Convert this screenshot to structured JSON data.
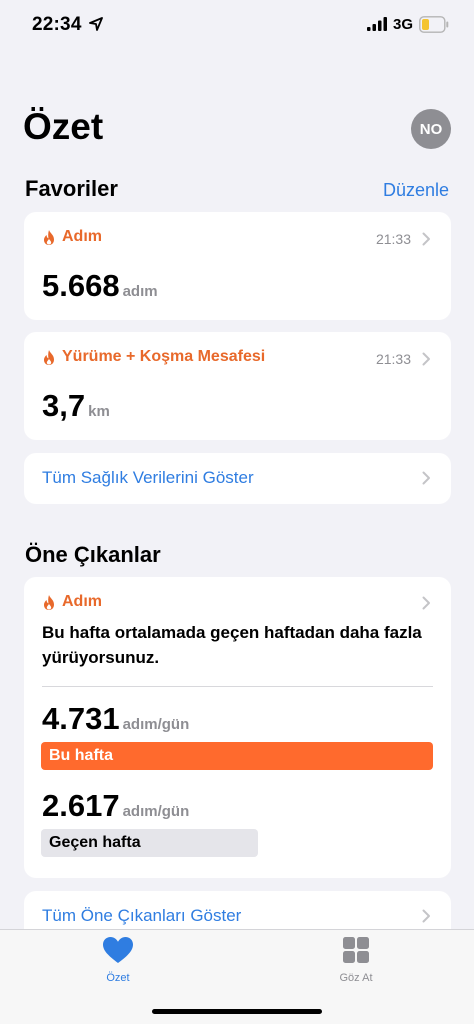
{
  "status_bar": {
    "time": "22:34",
    "network": "3G"
  },
  "header": {
    "title": "Özet",
    "avatar_initials": "NO"
  },
  "favorites": {
    "title": "Favoriler",
    "edit_label": "Düzenle",
    "cards": [
      {
        "label": "Adım",
        "time": "21:33",
        "value": "5.668",
        "unit": "adım"
      },
      {
        "label": "Yürüme + Koşma Mesafesi",
        "time": "21:33",
        "value": "3,7",
        "unit": "km"
      }
    ],
    "show_all_label": "Tüm Sağlık Verilerini Göster"
  },
  "highlights": {
    "title": "Öne Çıkanlar",
    "card": {
      "label": "Adım",
      "text": "Bu hafta ortalamada geçen haftadan daha fazla yürüyorsunuz.",
      "this_week_value": "4.731",
      "this_week_unit": "adım/gün",
      "this_week_label": "Bu hafta",
      "last_week_value": "2.617",
      "last_week_unit": "adım/gün",
      "last_week_label": "Geçen hafta",
      "this_week_number": 4731,
      "last_week_number": 2617
    },
    "show_all_label": "Tüm Öne Çıkanları Göster"
  },
  "tab_bar": {
    "tabs": [
      {
        "label": "Özet",
        "icon": "heart-icon",
        "active": true
      },
      {
        "label": "Göz At",
        "icon": "grid-icon",
        "active": false
      }
    ]
  },
  "colors": {
    "accent": "#2f7de1",
    "orange": "#e8692b",
    "bar_this_week": "#ff6a2d",
    "bar_last_week": "#e5e5ea"
  }
}
